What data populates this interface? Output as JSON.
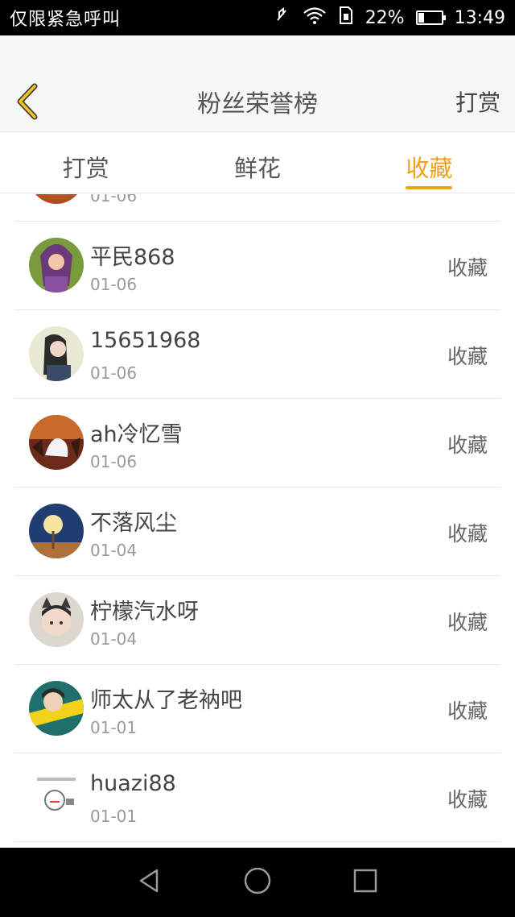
{
  "status_bar": {
    "carrier_text": "仅限紧急呼叫",
    "battery_percent": "22%",
    "time": "13:49",
    "battery_level": 0.22,
    "icons": [
      "mute-icon",
      "wifi-icon",
      "sim-icon",
      "battery-icon"
    ]
  },
  "header": {
    "title": "粉丝荣誉榜",
    "action_label": "打赏",
    "back_icon": "chevron-left-icon"
  },
  "tabs": [
    {
      "label": "打赏",
      "active": false
    },
    {
      "label": "鲜花",
      "active": false
    },
    {
      "label": "收藏",
      "active": true
    }
  ],
  "list": {
    "partial_top_item": {
      "date": "01-06"
    },
    "items": [
      {
        "name": "平民868",
        "date": "01-06",
        "action": "收藏"
      },
      {
        "name": "15651968",
        "date": "01-06",
        "action": "收藏"
      },
      {
        "name": "ah冷忆雪",
        "date": "01-06",
        "action": "收藏"
      },
      {
        "name": "不落风尘",
        "date": "01-04",
        "action": "收藏"
      },
      {
        "name": "柠檬汽水呀",
        "date": "01-04",
        "action": "收藏"
      },
      {
        "name": "师太从了老衲吧",
        "date": "01-01",
        "action": "收藏"
      },
      {
        "name": "huazi88",
        "date": "01-01",
        "action": "收藏"
      }
    ]
  },
  "nav_bar": {
    "icons": [
      "back-triangle-icon",
      "home-circle-icon",
      "recents-square-icon"
    ]
  },
  "colors": {
    "accent": "#f0a11a",
    "status_bar": "#000000",
    "header_bg": "#f7f7f7",
    "divider": "#e6e6e6"
  }
}
